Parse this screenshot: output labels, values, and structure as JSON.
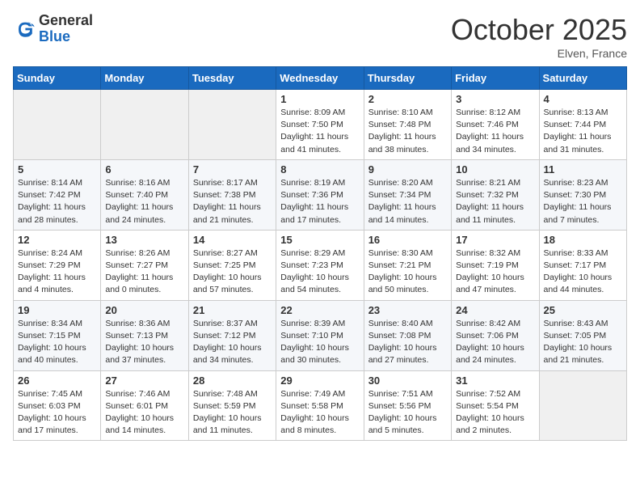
{
  "header": {
    "logo_general": "General",
    "logo_blue": "Blue",
    "month_title": "October 2025",
    "location": "Elven, France"
  },
  "weekdays": [
    "Sunday",
    "Monday",
    "Tuesday",
    "Wednesday",
    "Thursday",
    "Friday",
    "Saturday"
  ],
  "weeks": [
    [
      {
        "day": "",
        "info": ""
      },
      {
        "day": "",
        "info": ""
      },
      {
        "day": "",
        "info": ""
      },
      {
        "day": "1",
        "info": "Sunrise: 8:09 AM\nSunset: 7:50 PM\nDaylight: 11 hours and 41 minutes."
      },
      {
        "day": "2",
        "info": "Sunrise: 8:10 AM\nSunset: 7:48 PM\nDaylight: 11 hours and 38 minutes."
      },
      {
        "day": "3",
        "info": "Sunrise: 8:12 AM\nSunset: 7:46 PM\nDaylight: 11 hours and 34 minutes."
      },
      {
        "day": "4",
        "info": "Sunrise: 8:13 AM\nSunset: 7:44 PM\nDaylight: 11 hours and 31 minutes."
      }
    ],
    [
      {
        "day": "5",
        "info": "Sunrise: 8:14 AM\nSunset: 7:42 PM\nDaylight: 11 hours and 28 minutes."
      },
      {
        "day": "6",
        "info": "Sunrise: 8:16 AM\nSunset: 7:40 PM\nDaylight: 11 hours and 24 minutes."
      },
      {
        "day": "7",
        "info": "Sunrise: 8:17 AM\nSunset: 7:38 PM\nDaylight: 11 hours and 21 minutes."
      },
      {
        "day": "8",
        "info": "Sunrise: 8:19 AM\nSunset: 7:36 PM\nDaylight: 11 hours and 17 minutes."
      },
      {
        "day": "9",
        "info": "Sunrise: 8:20 AM\nSunset: 7:34 PM\nDaylight: 11 hours and 14 minutes."
      },
      {
        "day": "10",
        "info": "Sunrise: 8:21 AM\nSunset: 7:32 PM\nDaylight: 11 hours and 11 minutes."
      },
      {
        "day": "11",
        "info": "Sunrise: 8:23 AM\nSunset: 7:30 PM\nDaylight: 11 hours and 7 minutes."
      }
    ],
    [
      {
        "day": "12",
        "info": "Sunrise: 8:24 AM\nSunset: 7:29 PM\nDaylight: 11 hours and 4 minutes."
      },
      {
        "day": "13",
        "info": "Sunrise: 8:26 AM\nSunset: 7:27 PM\nDaylight: 11 hours and 0 minutes."
      },
      {
        "day": "14",
        "info": "Sunrise: 8:27 AM\nSunset: 7:25 PM\nDaylight: 10 hours and 57 minutes."
      },
      {
        "day": "15",
        "info": "Sunrise: 8:29 AM\nSunset: 7:23 PM\nDaylight: 10 hours and 54 minutes."
      },
      {
        "day": "16",
        "info": "Sunrise: 8:30 AM\nSunset: 7:21 PM\nDaylight: 10 hours and 50 minutes."
      },
      {
        "day": "17",
        "info": "Sunrise: 8:32 AM\nSunset: 7:19 PM\nDaylight: 10 hours and 47 minutes."
      },
      {
        "day": "18",
        "info": "Sunrise: 8:33 AM\nSunset: 7:17 PM\nDaylight: 10 hours and 44 minutes."
      }
    ],
    [
      {
        "day": "19",
        "info": "Sunrise: 8:34 AM\nSunset: 7:15 PM\nDaylight: 10 hours and 40 minutes."
      },
      {
        "day": "20",
        "info": "Sunrise: 8:36 AM\nSunset: 7:13 PM\nDaylight: 10 hours and 37 minutes."
      },
      {
        "day": "21",
        "info": "Sunrise: 8:37 AM\nSunset: 7:12 PM\nDaylight: 10 hours and 34 minutes."
      },
      {
        "day": "22",
        "info": "Sunrise: 8:39 AM\nSunset: 7:10 PM\nDaylight: 10 hours and 30 minutes."
      },
      {
        "day": "23",
        "info": "Sunrise: 8:40 AM\nSunset: 7:08 PM\nDaylight: 10 hours and 27 minutes."
      },
      {
        "day": "24",
        "info": "Sunrise: 8:42 AM\nSunset: 7:06 PM\nDaylight: 10 hours and 24 minutes."
      },
      {
        "day": "25",
        "info": "Sunrise: 8:43 AM\nSunset: 7:05 PM\nDaylight: 10 hours and 21 minutes."
      }
    ],
    [
      {
        "day": "26",
        "info": "Sunrise: 7:45 AM\nSunset: 6:03 PM\nDaylight: 10 hours and 17 minutes."
      },
      {
        "day": "27",
        "info": "Sunrise: 7:46 AM\nSunset: 6:01 PM\nDaylight: 10 hours and 14 minutes."
      },
      {
        "day": "28",
        "info": "Sunrise: 7:48 AM\nSunset: 5:59 PM\nDaylight: 10 hours and 11 minutes."
      },
      {
        "day": "29",
        "info": "Sunrise: 7:49 AM\nSunset: 5:58 PM\nDaylight: 10 hours and 8 minutes."
      },
      {
        "day": "30",
        "info": "Sunrise: 7:51 AM\nSunset: 5:56 PM\nDaylight: 10 hours and 5 minutes."
      },
      {
        "day": "31",
        "info": "Sunrise: 7:52 AM\nSunset: 5:54 PM\nDaylight: 10 hours and 2 minutes."
      },
      {
        "day": "",
        "info": ""
      }
    ]
  ]
}
